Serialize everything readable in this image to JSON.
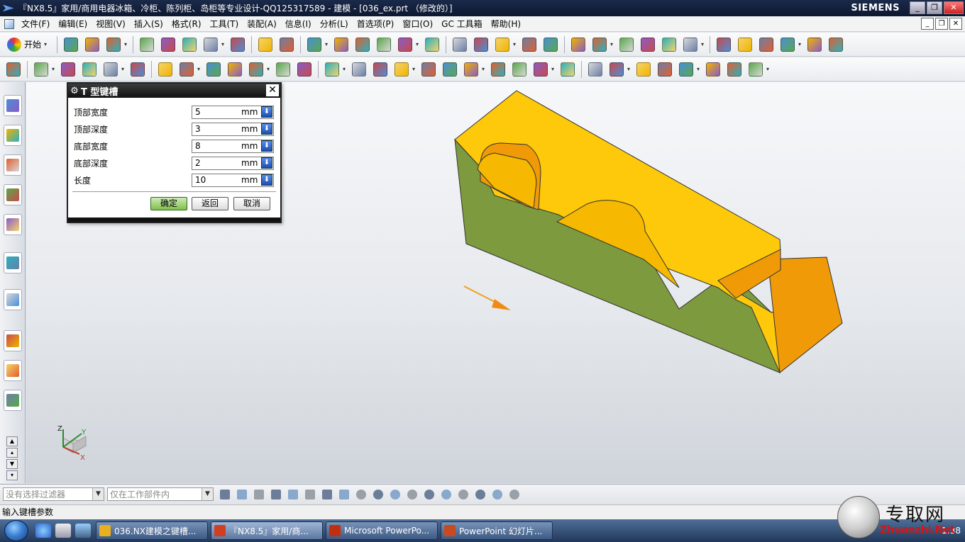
{
  "window": {
    "title": "『NX8.5』家用/商用电器冰箱、冷柜、陈列柜、岛柜等专业设计-QQ125317589 - 建模 - [036_ex.prt （修改的）]",
    "brand": "SIEMENS",
    "buttons": [
      "_",
      "❐",
      "✕"
    ]
  },
  "menubar": {
    "items": [
      "文件(F)",
      "编辑(E)",
      "视图(V)",
      "插入(S)",
      "格式(R)",
      "工具(T)",
      "装配(A)",
      "信息(I)",
      "分析(L)",
      "首选项(P)",
      "窗口(O)",
      "GC 工具箱",
      "帮助(H)"
    ],
    "mdi_buttons": [
      "_",
      "❐",
      "✕"
    ]
  },
  "toolbar1": {
    "start_label": "开始",
    "icons": [
      "new-file-icon",
      "open-folder-icon",
      "save-icon",
      "cut-icon",
      "copy-icon",
      "paste-icon",
      "undo-icon",
      "redo-icon",
      "view-orient-icon",
      "command-finder-icon",
      "fit-view-icon",
      "shaded-view-icon",
      "cube-view-icon",
      "section-view-icon",
      "perspective-icon",
      "background-icon",
      "snap-view-icon",
      "select-cursor-icon",
      "layer-icon",
      "wcs-icon",
      "measure-icon",
      "distance-icon",
      "analysis-icon",
      "grid-icon",
      "layout-icon",
      "layer-settings-icon",
      "sheet-icon",
      "ruler-icon",
      "view-triad-icon",
      "hide-icon",
      "reference-icon",
      "info-icon",
      "properties-icon"
    ]
  },
  "toolbar2": {
    "icons": [
      "sketch-icon",
      "extrude-icon",
      "revolve-icon",
      "block-icon",
      "cylinder-icon",
      "hole-icon",
      "boss-icon",
      "pocket-icon",
      "pad-icon",
      "slot-icon",
      "groove-icon",
      "datum-plane-icon",
      "datum-axis-icon",
      "unite-icon",
      "subtract-icon",
      "edge-blend-icon",
      "chamfer-icon",
      "draft-icon",
      "shell-icon",
      "mirror-icon",
      "pattern-icon",
      "trim-body-icon",
      "split-body-icon",
      "offset-face-icon",
      "thicken-icon",
      "sew-icon",
      "surface-icon",
      "sweep-icon",
      "through-curves-icon",
      "bounded-plane-icon",
      "extract-icon",
      "wrap-icon"
    ]
  },
  "resource_bar": {
    "icons": [
      "assembly-navigator-icon",
      "constraint-navigator-icon",
      "part-navigator-icon",
      "reuse-library-icon",
      "hd3d-tools-icon",
      "web-browser-icon",
      "history-icon",
      "process-studio-icon",
      "roles-icon",
      "system-materials-icon"
    ]
  },
  "dialog": {
    "title": "T 型键槽",
    "fields": [
      {
        "label": "顶部宽度",
        "value": "5",
        "unit": "mm"
      },
      {
        "label": "顶部深度",
        "value": "3",
        "unit": "mm"
      },
      {
        "label": "底部宽度",
        "value": "8",
        "unit": "mm"
      },
      {
        "label": "底部深度",
        "value": "2",
        "unit": "mm"
      },
      {
        "label": "长度",
        "value": "10",
        "unit": "mm"
      }
    ],
    "buttons": {
      "ok": "确定",
      "back": "返回",
      "cancel": "取消"
    }
  },
  "viewport": {
    "triad": {
      "x": "X",
      "y": "Y",
      "z": "Z"
    },
    "colors": {
      "top_face": "#fdc90a",
      "side_face": "#7e9a3e",
      "end_face": "#f09a08",
      "slot_face": "#f6b800"
    }
  },
  "selection_bar": {
    "filter_placeholder": "没有选择过滤器",
    "scope": "仅在工作部件内"
  },
  "status": {
    "prompt": "输入键槽参数"
  },
  "taskbar": {
    "tasks": [
      {
        "label": "036.NX建模之键槽..."
      },
      {
        "label": "『NX8.5』家用/商..."
      },
      {
        "label": "Microsoft PowerPo..."
      },
      {
        "label": "PowerPoint 幻灯片..."
      }
    ],
    "clock": "1:38"
  },
  "watermark": {
    "cn": "专取网",
    "en": "Zhuanzhi.Net"
  }
}
